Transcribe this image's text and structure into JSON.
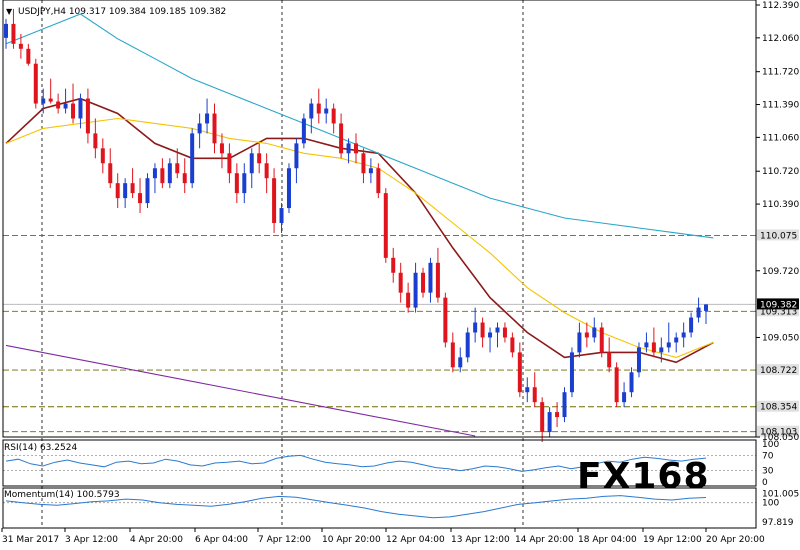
{
  "chart_data": {
    "type": "candlestick",
    "symbol": "USDJPY,H4",
    "header_values": [
      "109.317",
      "109.384",
      "109.185",
      "109.382"
    ],
    "price_axis": {
      "min": 108.05,
      "max": 112.4,
      "ticks": [
        "112.390",
        "112.060",
        "111.720",
        "111.390",
        "111.060",
        "110.720",
        "110.390",
        "109.720",
        "109.050",
        "108.050"
      ]
    },
    "levels": [
      {
        "value": 110.075,
        "label": "110.075",
        "style": "dashed"
      },
      {
        "value": 109.313,
        "label": "109.313",
        "style": "dashed"
      },
      {
        "value": 108.722,
        "label": "108.722",
        "style": "dashed"
      },
      {
        "value": 108.354,
        "label": "108.354",
        "style": "dashed"
      },
      {
        "value": 108.103,
        "label": "108.103",
        "style": "dashed"
      },
      {
        "value": 109.382,
        "label": "109.382",
        "style": "bid"
      }
    ],
    "x_ticks": [
      "31 Mar 2017",
      "3 Apr 12:00",
      "4 Apr 20:00",
      "6 Apr 04:00",
      "7 Apr 12:00",
      "10 Apr 20:00",
      "12 Apr 04:00",
      "13 Apr 12:00",
      "14 Apr 20:00",
      "18 Apr 04:00",
      "19 Apr 12:00",
      "20 Apr 20:00"
    ],
    "candles": [
      [
        112.06,
        112.25,
        111.95,
        112.2
      ],
      [
        112.2,
        112.35,
        111.95,
        112.0
      ],
      [
        112.0,
        112.1,
        111.85,
        111.95
      ],
      [
        111.95,
        112.0,
        111.78,
        111.8
      ],
      [
        111.8,
        111.85,
        111.35,
        111.4
      ],
      [
        111.4,
        111.55,
        111.3,
        111.45
      ],
      [
        111.45,
        111.65,
        111.4,
        111.42
      ],
      [
        111.42,
        111.5,
        111.3,
        111.35
      ],
      [
        111.35,
        111.55,
        111.3,
        111.4
      ],
      [
        111.4,
        111.6,
        111.2,
        111.25
      ],
      [
        111.25,
        111.5,
        111.15,
        111.45
      ],
      [
        111.45,
        111.55,
        111.0,
        111.1
      ],
      [
        111.1,
        111.25,
        110.85,
        110.95
      ],
      [
        110.95,
        111.05,
        110.7,
        110.8
      ],
      [
        110.8,
        110.95,
        110.55,
        110.6
      ],
      [
        110.6,
        110.7,
        110.35,
        110.45
      ],
      [
        110.45,
        110.65,
        110.35,
        110.6
      ],
      [
        110.6,
        110.75,
        110.45,
        110.5
      ],
      [
        110.5,
        110.65,
        110.3,
        110.4
      ],
      [
        110.4,
        110.7,
        110.35,
        110.65
      ],
      [
        110.65,
        110.8,
        110.5,
        110.75
      ],
      [
        110.75,
        110.85,
        110.55,
        110.6
      ],
      [
        110.6,
        110.85,
        110.55,
        110.8
      ],
      [
        110.8,
        110.95,
        110.65,
        110.7
      ],
      [
        110.7,
        110.85,
        110.5,
        110.6
      ],
      [
        110.6,
        111.15,
        110.55,
        111.1
      ],
      [
        111.1,
        111.3,
        110.95,
        111.2
      ],
      [
        111.2,
        111.45,
        111.1,
        111.3
      ],
      [
        111.3,
        111.4,
        110.9,
        111.0
      ],
      [
        111.0,
        111.1,
        110.75,
        110.9
      ],
      [
        110.9,
        111.0,
        110.6,
        110.7
      ],
      [
        110.7,
        110.8,
        110.4,
        110.5
      ],
      [
        110.5,
        110.8,
        110.4,
        110.7
      ],
      [
        110.7,
        110.95,
        110.55,
        110.9
      ],
      [
        110.9,
        111.0,
        110.7,
        110.8
      ],
      [
        110.8,
        110.9,
        110.5,
        110.65
      ],
      [
        110.65,
        110.75,
        110.1,
        110.2
      ],
      [
        110.2,
        110.4,
        110.1,
        110.35
      ],
      [
        110.35,
        110.8,
        110.3,
        110.75
      ],
      [
        110.75,
        111.05,
        110.6,
        111.0
      ],
      [
        111.0,
        111.3,
        110.95,
        111.25
      ],
      [
        111.25,
        111.45,
        111.1,
        111.4
      ],
      [
        111.4,
        111.55,
        111.2,
        111.3
      ],
      [
        111.3,
        111.45,
        111.2,
        111.35
      ],
      [
        111.35,
        111.4,
        111.1,
        111.2
      ],
      [
        111.2,
        111.3,
        110.85,
        110.9
      ],
      [
        110.9,
        111.05,
        110.8,
        111.0
      ],
      [
        111.0,
        111.1,
        110.8,
        110.9
      ],
      [
        110.9,
        110.95,
        110.6,
        110.7
      ],
      [
        110.7,
        110.85,
        110.6,
        110.75
      ],
      [
        110.75,
        110.8,
        110.45,
        110.5
      ],
      [
        110.5,
        110.55,
        109.8,
        109.85
      ],
      [
        109.85,
        109.95,
        109.6,
        109.7
      ],
      [
        109.7,
        109.8,
        109.4,
        109.5
      ],
      [
        109.5,
        109.6,
        109.3,
        109.35
      ],
      [
        109.35,
        109.8,
        109.3,
        109.7
      ],
      [
        109.7,
        109.75,
        109.45,
        109.5
      ],
      [
        109.5,
        109.85,
        109.4,
        109.8
      ],
      [
        109.8,
        109.95,
        109.4,
        109.45
      ],
      [
        109.45,
        109.5,
        108.95,
        109.0
      ],
      [
        109.0,
        109.1,
        108.7,
        108.75
      ],
      [
        108.75,
        108.95,
        108.7,
        108.85
      ],
      [
        108.85,
        109.15,
        108.8,
        109.1
      ],
      [
        109.1,
        109.35,
        109.0,
        109.2
      ],
      [
        109.2,
        109.25,
        108.95,
        109.05
      ],
      [
        109.05,
        109.15,
        108.9,
        109.1
      ],
      [
        109.1,
        109.2,
        108.95,
        109.15
      ],
      [
        109.15,
        109.2,
        109.0,
        109.05
      ],
      [
        109.05,
        109.1,
        108.85,
        108.9
      ],
      [
        108.9,
        109.0,
        108.45,
        108.5
      ],
      [
        108.5,
        108.65,
        108.4,
        108.55
      ],
      [
        108.55,
        108.7,
        108.35,
        108.4
      ],
      [
        108.4,
        108.45,
        108.0,
        108.1
      ],
      [
        108.1,
        108.35,
        108.05,
        108.3
      ],
      [
        108.3,
        108.4,
        108.15,
        108.25
      ],
      [
        108.25,
        108.55,
        108.2,
        108.5
      ],
      [
        108.5,
        108.95,
        108.45,
        108.9
      ],
      [
        108.9,
        109.2,
        108.85,
        109.1
      ],
      [
        109.1,
        109.2,
        108.95,
        109.05
      ],
      [
        109.05,
        109.25,
        109.0,
        109.15
      ],
      [
        109.15,
        109.2,
        108.85,
        108.9
      ],
      [
        108.9,
        109.05,
        108.7,
        108.75
      ],
      [
        108.75,
        108.8,
        108.35,
        108.4
      ],
      [
        108.4,
        108.6,
        108.35,
        108.5
      ],
      [
        108.5,
        108.75,
        108.45,
        108.7
      ],
      [
        108.7,
        109.0,
        108.65,
        108.95
      ],
      [
        108.95,
        109.1,
        108.9,
        109.0
      ],
      [
        109.0,
        109.15,
        108.85,
        108.9
      ],
      [
        108.9,
        109.05,
        108.8,
        108.95
      ],
      [
        108.95,
        109.2,
        108.9,
        109.0
      ],
      [
        109.0,
        109.1,
        108.9,
        109.05
      ],
      [
        109.05,
        109.2,
        108.95,
        109.1
      ],
      [
        109.1,
        109.3,
        109.05,
        109.25
      ],
      [
        109.25,
        109.45,
        109.2,
        109.35
      ],
      [
        109.317,
        109.384,
        109.185,
        109.382
      ]
    ],
    "moving_averages": [
      {
        "color": "#8b1a1a",
        "points": [
          [
            0,
            111.0
          ],
          [
            5,
            111.35
          ],
          [
            10,
            111.45
          ],
          [
            15,
            111.3
          ],
          [
            20,
            111.0
          ],
          [
            25,
            110.85
          ],
          [
            30,
            110.85
          ],
          [
            35,
            111.05
          ],
          [
            40,
            111.05
          ],
          [
            45,
            110.95
          ],
          [
            50,
            110.9
          ],
          [
            55,
            110.5
          ],
          [
            60,
            109.95
          ],
          [
            65,
            109.45
          ],
          [
            70,
            109.1
          ],
          [
            75,
            108.85
          ],
          [
            80,
            108.9
          ],
          [
            85,
            108.9
          ],
          [
            90,
            108.8
          ],
          [
            95,
            109.0
          ]
        ]
      },
      {
        "color": "#f5c400",
        "points": [
          [
            0,
            111.0
          ],
          [
            5,
            111.15
          ],
          [
            10,
            111.2
          ],
          [
            15,
            111.25
          ],
          [
            20,
            111.2
          ],
          [
            25,
            111.15
          ],
          [
            30,
            111.05
          ],
          [
            35,
            111.0
          ],
          [
            40,
            110.9
          ],
          [
            45,
            110.85
          ],
          [
            50,
            110.75
          ],
          [
            55,
            110.5
          ],
          [
            60,
            110.2
          ],
          [
            65,
            109.9
          ],
          [
            70,
            109.55
          ],
          [
            75,
            109.3
          ],
          [
            80,
            109.1
          ],
          [
            85,
            108.95
          ],
          [
            90,
            108.85
          ],
          [
            95,
            109.0
          ]
        ]
      },
      {
        "color": "#2aa6c8",
        "points": [
          [
            0,
            112.0
          ],
          [
            5,
            112.15
          ],
          [
            10,
            112.3
          ],
          [
            15,
            112.05
          ],
          [
            20,
            111.85
          ],
          [
            25,
            111.65
          ],
          [
            30,
            111.5
          ],
          [
            35,
            111.35
          ],
          [
            40,
            111.2
          ],
          [
            45,
            111.05
          ],
          [
            50,
            110.9
          ],
          [
            55,
            110.75
          ],
          [
            60,
            110.6
          ],
          [
            65,
            110.45
          ],
          [
            70,
            110.35
          ],
          [
            75,
            110.25
          ],
          [
            80,
            110.2
          ],
          [
            85,
            110.15
          ],
          [
            90,
            110.1
          ],
          [
            95,
            110.05
          ]
        ]
      }
    ],
    "trendline": {
      "color": "#7f2aa0",
      "points": [
        [
          0,
          108.97
        ],
        [
          63,
          108.06
        ]
      ]
    },
    "rsi": {
      "label": "RSI(14) 63.2524",
      "ticks": [
        "100",
        "70",
        "30",
        "0"
      ],
      "color": "#2a7ad2",
      "values": [
        55,
        60,
        48,
        42,
        52,
        58,
        50,
        45,
        40,
        52,
        55,
        48,
        50,
        60,
        55,
        45,
        42,
        50,
        52,
        55,
        48,
        50,
        62,
        68,
        70,
        60,
        52,
        48,
        45,
        40,
        42,
        50,
        55,
        52,
        45,
        38,
        35,
        30,
        35,
        42,
        40,
        35,
        28,
        32,
        38,
        42,
        35,
        40,
        48,
        55,
        52,
        60,
        65,
        62,
        58,
        55,
        60,
        63
      ]
    },
    "momentum": {
      "label": "Momentum(14) 100.5793",
      "ticks": [
        "101.0053",
        "100",
        "97.819"
      ],
      "color": "#2a7ad2",
      "values": [
        100.2,
        100.0,
        99.8,
        99.7,
        99.9,
        100.1,
        100.2,
        100.4,
        100.3,
        100.0,
        99.8,
        99.7,
        99.6,
        99.8,
        100.1,
        100.5,
        100.7,
        100.6,
        100.3,
        100.0,
        99.7,
        99.4,
        99.0,
        98.7,
        98.5,
        98.3,
        98.4,
        98.7,
        99.0,
        99.4,
        99.8,
        100.0,
        100.2,
        100.4,
        100.5,
        100.7,
        100.8,
        100.6,
        100.4,
        100.3,
        100.5,
        100.58
      ]
    },
    "watermark": "FX168"
  }
}
